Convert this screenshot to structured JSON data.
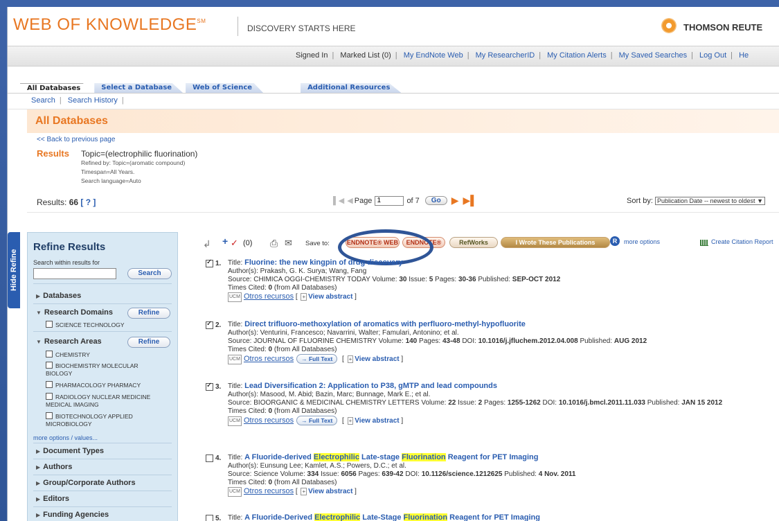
{
  "header": {
    "logo_text": "WEB OF KNOWLEDGE",
    "logo_mark": "SM",
    "tagline": "DISCOVERY STARTS HERE",
    "vendor": "THOMSON REUTE"
  },
  "user_bar": {
    "signed_in": "Signed In",
    "marked_list": "Marked List (0)",
    "links": [
      "My EndNote Web",
      "My ResearcherID",
      "My Citation Alerts",
      "My Saved Searches",
      "Log Out",
      "He"
    ]
  },
  "tabs": [
    "All Databases",
    "Select a Database",
    "Web of Science",
    "Additional Resources"
  ],
  "subnav": [
    "Search",
    "Search History"
  ],
  "page_title": "All Databases",
  "back_link": "<< Back to previous page",
  "results": {
    "label": "Results",
    "topic": "Topic=(electrophilic fluorination)",
    "refined_by": "Refined by: Topic=(aromatic compound)",
    "timespan": "Timespan=All Years.",
    "language": "Search language=Auto",
    "count_label": "Results:",
    "count": "66",
    "help": "[ ? ]"
  },
  "pager": {
    "page_label": "Page",
    "page_value": "1",
    "of_label": "of 7",
    "go": "Go"
  },
  "sort": {
    "label": "Sort by:",
    "value": "Publication Date -- newest to oldest"
  },
  "sidebar": {
    "hide_label": "Hide Refine",
    "title": "Refine Results",
    "search_label": "Search within results for",
    "search_button": "Search",
    "databases": "Databases",
    "research_domains": "Research Domains",
    "refine_button": "Refine",
    "domain_items": [
      "SCIENCE TECHNOLOGY"
    ],
    "research_areas": "Research Areas",
    "area_items": [
      "CHEMISTRY",
      "BIOCHEMISTRY MOLECULAR BIOLOGY",
      "PHARMACOLOGY PHARMACY",
      "RADIOLOGY NUCLEAR MEDICINE MEDICAL IMAGING",
      "BIOTECHNOLOGY APPLIED MICROBIOLOGY"
    ],
    "more_options": "more options / values...",
    "sections": [
      "Document Types",
      "Authors",
      "Group/Corporate Authors",
      "Editors",
      "Funding Agencies"
    ]
  },
  "toolbar": {
    "marked_count": "(0)",
    "save_to": "Save to:",
    "endnote_web": "ENDNOTE® WEB",
    "endnote": "ENDNOTE®",
    "refworks": "RefWorks",
    "wrote": "I Wrote These Publications",
    "r_badge": "R",
    "more_options": "more options",
    "citation_report": "Create Citation Report"
  },
  "labels": {
    "title": "Title:",
    "times_cited": "Times Cited:",
    "from_all": "(from All Databases)",
    "otros": "Otros recursos",
    "full_text": "→ Full Text",
    "view_abstract": "View abstract",
    "ucm": "UCM"
  },
  "records": [
    {
      "num": "1.",
      "checked": true,
      "title": "Fluorine: the new kingpin of drug discovery",
      "authors": "Author(s): Prakash, G. K. Surya; Wang, Fang",
      "source": "Source: CHIMICA OGGI-CHEMISTRY TODAY",
      "details": [
        {
          "k": "Volume:",
          "v": "30"
        },
        {
          "k": "Issue:",
          "v": "5"
        },
        {
          "k": "Pages:",
          "v": "30-36"
        },
        {
          "k": "Published:",
          "v": "SEP-OCT 2012"
        }
      ],
      "cited": "0",
      "full_text": false
    },
    {
      "num": "2.",
      "checked": true,
      "title": "Direct trifluoro-methoxylation of aromatics with perfluoro-methyl-hypofluorite",
      "authors": "Author(s): Venturini, Francesco; Navarrini, Walter; Famulari, Antonino; et al.",
      "source": "Source: JOURNAL OF FLUORINE CHEMISTRY",
      "details": [
        {
          "k": "Volume:",
          "v": "140"
        },
        {
          "k": "Pages:",
          "v": "43-48"
        },
        {
          "k": "DOI:",
          "v": "10.1016/j.jfluchem.2012.04.008"
        },
        {
          "k": "Published:",
          "v": "AUG 2012"
        }
      ],
      "cited": "0",
      "full_text": true
    },
    {
      "num": "3.",
      "checked": true,
      "title": "Lead Diversification 2: Application to P38, gMTP and lead compounds",
      "authors": "Author(s): Masood, M. Abid; Bazin, Marc; Bunnage, Mark E.; et al.",
      "source": "Source: BIOORGANIC & MEDICINAL CHEMISTRY LETTERS",
      "details": [
        {
          "k": "Volume:",
          "v": "22"
        },
        {
          "k": "Issue:",
          "v": "2"
        },
        {
          "k": "Pages:",
          "v": "1255-1262"
        },
        {
          "k": "DOI:",
          "v": "10.1016/j.bmcl.2011.11.033"
        },
        {
          "k": "Published:",
          "v": "JAN 15 2012"
        }
      ],
      "cited": "0",
      "full_text": true
    },
    {
      "num": "4.",
      "checked": false,
      "title_parts": [
        "A Fluoride-derived ",
        "Electrophilic",
        " Late-stage ",
        "Fluorination",
        " Reagent for PET Imaging"
      ],
      "authors": "Author(s): Eunsung Lee; Kamlet, A.S.; Powers, D.C.; et al.",
      "source": "Source: Science",
      "details": [
        {
          "k": "Volume:",
          "v": "334"
        },
        {
          "k": "Issue:",
          "v": "6056"
        },
        {
          "k": "Pages:",
          "v": "639-42"
        },
        {
          "k": "DOI:",
          "v": "10.1126/science.1212625"
        },
        {
          "k": "Published:",
          "v": "4 Nov. 2011"
        }
      ],
      "cited": "0",
      "full_text": false
    },
    {
      "num": "5.",
      "checked": false,
      "title_parts": [
        "A Fluoride-Derived ",
        "Electrophilic",
        " Late-Stage ",
        "Fluorination",
        " Reagent for PET Imaging"
      ]
    }
  ],
  "colors": {
    "brand_orange": "#e87722",
    "link_blue": "#2a5db0",
    "frame_blue": "#2f5597",
    "highlight": "#ffff33"
  }
}
